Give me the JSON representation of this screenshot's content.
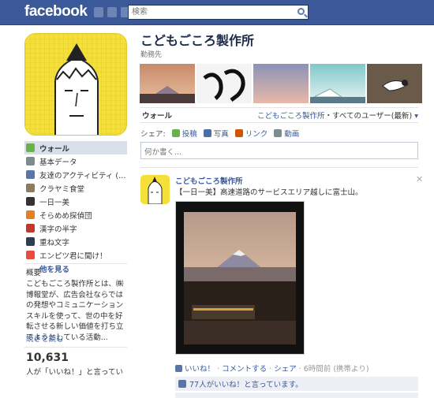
{
  "topbar": {
    "logo": "facebook",
    "search_placeholder": "検索",
    "jewels": [
      "friend-requests-icon",
      "messages-icon",
      "notifications-icon"
    ]
  },
  "page": {
    "title": "こどもごころ製作所",
    "subtitle": "勤務先"
  },
  "sidebar": {
    "items": [
      {
        "label": "ウォール",
        "icon": "wall-icon",
        "color": "#6ab04c",
        "active": true
      },
      {
        "label": "基本データ",
        "icon": "info-icon",
        "color": "#7f8c8d",
        "active": false
      },
      {
        "label": "友達のアクティビティ (…",
        "icon": "activity-icon",
        "color": "#5b74a8",
        "active": false
      },
      {
        "label": "クラヤミ食堂",
        "icon": "app-icon",
        "color": "#8e7b5a",
        "active": false
      },
      {
        "label": "一日一美",
        "icon": "app-icon",
        "color": "#333333",
        "active": false
      },
      {
        "label": "そらめめ探偵団",
        "icon": "app-icon",
        "color": "#e67e22",
        "active": false
      },
      {
        "label": "漢字の半字",
        "icon": "app-icon",
        "color": "#c0392b",
        "active": false
      },
      {
        "label": "重ね文字",
        "icon": "app-icon",
        "color": "#2c3e50",
        "active": false
      },
      {
        "label": "エンピツ君に聞け！",
        "icon": "app-icon",
        "color": "#e74c3c",
        "active": false
      }
    ],
    "more_label": "他を見る",
    "about_heading": "概要",
    "about_text": "こどもごころ製作所とは、㈱博報堂が、広告会社ならではの発想やコミュニケーションスキルを使って、世の中を好転させる新しい価値を打ち立てようとしている活動...",
    "read_more": "続きを読む",
    "likes_count": "10,631",
    "likes_text": "人が「いいね！」と言ってい"
  },
  "tabs": {
    "wall": "ウォール",
    "filter_link": "こどもごころ製作所",
    "filter_rest": "・すべてのユーザー(最新)"
  },
  "share": {
    "label": "シェア:",
    "items": [
      {
        "label": "投稿",
        "icon": "post-icon",
        "color": "#6ab04c"
      },
      {
        "label": "写真",
        "icon": "photo-icon",
        "color": "#4a6fa5"
      },
      {
        "label": "リンク",
        "icon": "link-icon",
        "color": "#d35400"
      },
      {
        "label": "動画",
        "icon": "video-icon",
        "color": "#7f8c8d"
      }
    ]
  },
  "composer": {
    "placeholder": "何か書く..."
  },
  "post": {
    "author": "こどもごころ製作所",
    "text": "【一日一美】高速道路のサービスエリア越しに富士山。",
    "like": "いいね！",
    "comment": "コメントする",
    "share": "シェア",
    "time": "6時間前 (携帯より)",
    "likes_summary": "77人がいいね！と言っています。"
  }
}
